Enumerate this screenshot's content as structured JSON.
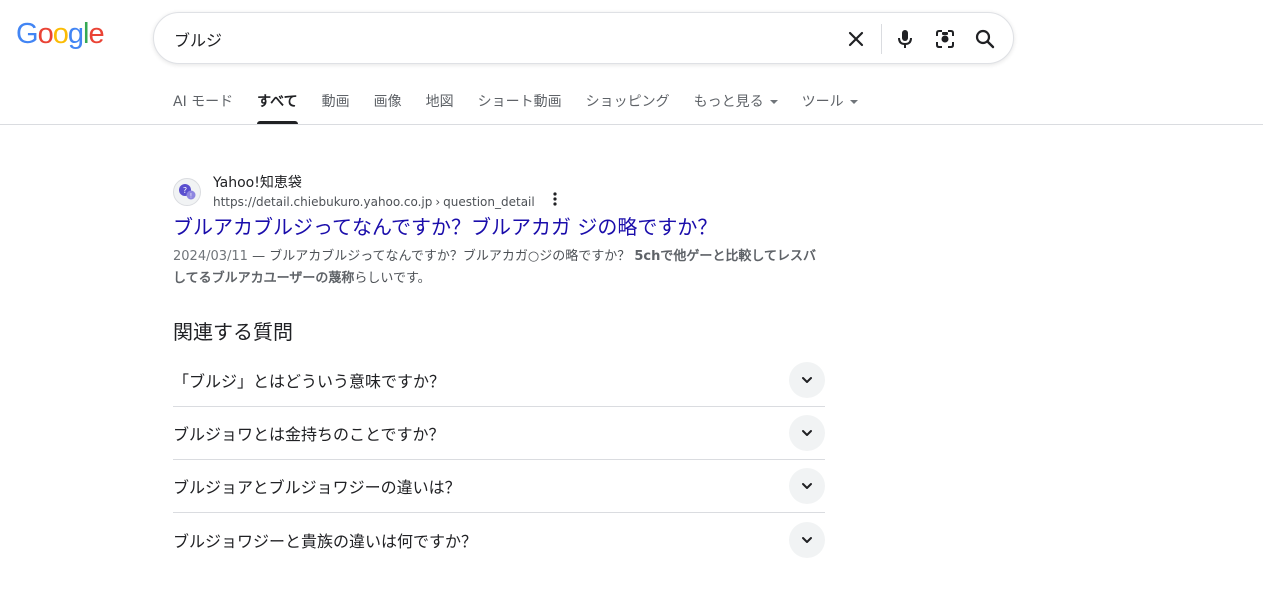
{
  "logo": {
    "letters": [
      "G",
      "o",
      "o",
      "g",
      "l",
      "e"
    ],
    "colors": [
      "#4285F4",
      "#EA4335",
      "#FBBC05",
      "#4285F4",
      "#34A853",
      "#EA4335"
    ]
  },
  "search": {
    "query": "ブルジ",
    "icons": [
      "close-icon",
      "microphone-icon",
      "camera-lens-icon",
      "search-icon"
    ]
  },
  "tabs": [
    {
      "label": "AI モード",
      "active": false
    },
    {
      "label": "すべて",
      "active": true
    },
    {
      "label": "動画",
      "active": false
    },
    {
      "label": "画像",
      "active": false
    },
    {
      "label": "地図",
      "active": false
    },
    {
      "label": "ショート動画",
      "active": false
    },
    {
      "label": "ショッピング",
      "active": false
    },
    {
      "label": "もっと見る",
      "active": false,
      "dropdown": true
    },
    {
      "label": "ツール",
      "active": false,
      "dropdown": true
    }
  ],
  "result": {
    "site_name": "Yahoo!知恵袋",
    "url_domain": "https://detail.chiebukuro.yahoo.co.jp",
    "url_separator": "›",
    "url_path": "question_detail",
    "title": "ブルアカブルジってなんですか？ブルアカガ ジの略ですか？",
    "date": "2024/03/11",
    "dash": " — ",
    "snippet_plain": "ブルアカブルジってなんですか？ブルアカガ○ジの略ですか？ ",
    "snippet_bold": "5chで他ゲーと比較してレスバしてるブルアカユーザーの蔑称",
    "snippet_tail": "らしいです。"
  },
  "related": {
    "title": "関連する質問",
    "questions": [
      "「ブルジ」とはどういう意味ですか？",
      "ブルジョワとは金持ちのことですか？",
      "ブルジョアとブルジョワジーの違いは？",
      "ブルジョワジーと貴族の違いは何ですか？"
    ]
  },
  "colors": {
    "link": "#1a0dab",
    "text": "#202124",
    "secondary": "#4d5156"
  }
}
